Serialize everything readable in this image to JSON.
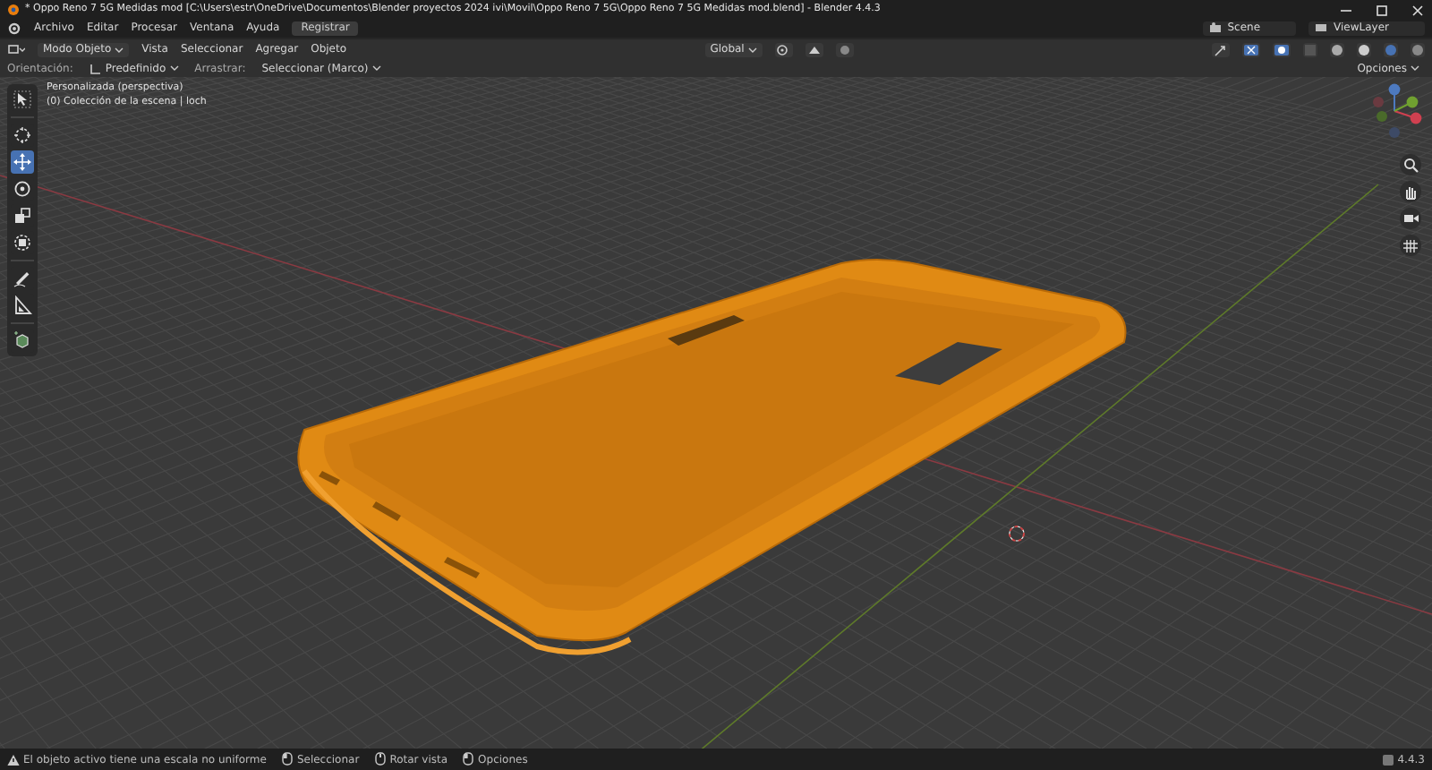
{
  "window": {
    "title": "* Oppo Reno 7 5G Medidas mod [C:\\Users\\estr\\OneDrive\\Documentos\\Blender proyectos 2024 ivi\\Movil\\Oppo Reno 7 5G\\Oppo Reno 7 5G Medidas mod.blend] - Blender 4.4.3"
  },
  "menu": [
    "Archivo",
    "Editar",
    "Procesar",
    "Ventana",
    "Ayuda"
  ],
  "register_button": "Registrar",
  "scene": "Scene",
  "view_layer": "ViewLayer",
  "header": {
    "mode": "Modo Objeto",
    "menus": [
      "Vista",
      "Seleccionar",
      "Agregar",
      "Objeto"
    ],
    "transform": "Global"
  },
  "tool_settings": {
    "orientation_label": "Orientación:",
    "orientation": "Predefinido",
    "drag_label": "Arrastrar:",
    "drag": "Seleccionar (Marco)",
    "options": "Opciones"
  },
  "viewport": {
    "view_name": "Personalizada (perspectiva)",
    "collection": "(0) Colección de la escena | loch"
  },
  "tools": [
    {
      "kind": "select",
      "selected": false
    },
    {
      "kind": "cursor",
      "selected": false
    },
    {
      "kind": "move",
      "selected": true
    },
    {
      "kind": "rotate",
      "selected": false
    },
    {
      "kind": "scale",
      "selected": false
    },
    {
      "kind": "transform",
      "selected": false
    },
    {
      "kind": "annotate",
      "selected": false
    },
    {
      "kind": "measure",
      "selected": false
    },
    {
      "kind": "add-cube",
      "selected": false
    }
  ],
  "status_bar": {
    "warning": "El objeto activo tiene una escala no uniforme",
    "hints": [
      "Seleccionar",
      "Rotar vista",
      "Opciones"
    ],
    "version": "4.4.3"
  }
}
